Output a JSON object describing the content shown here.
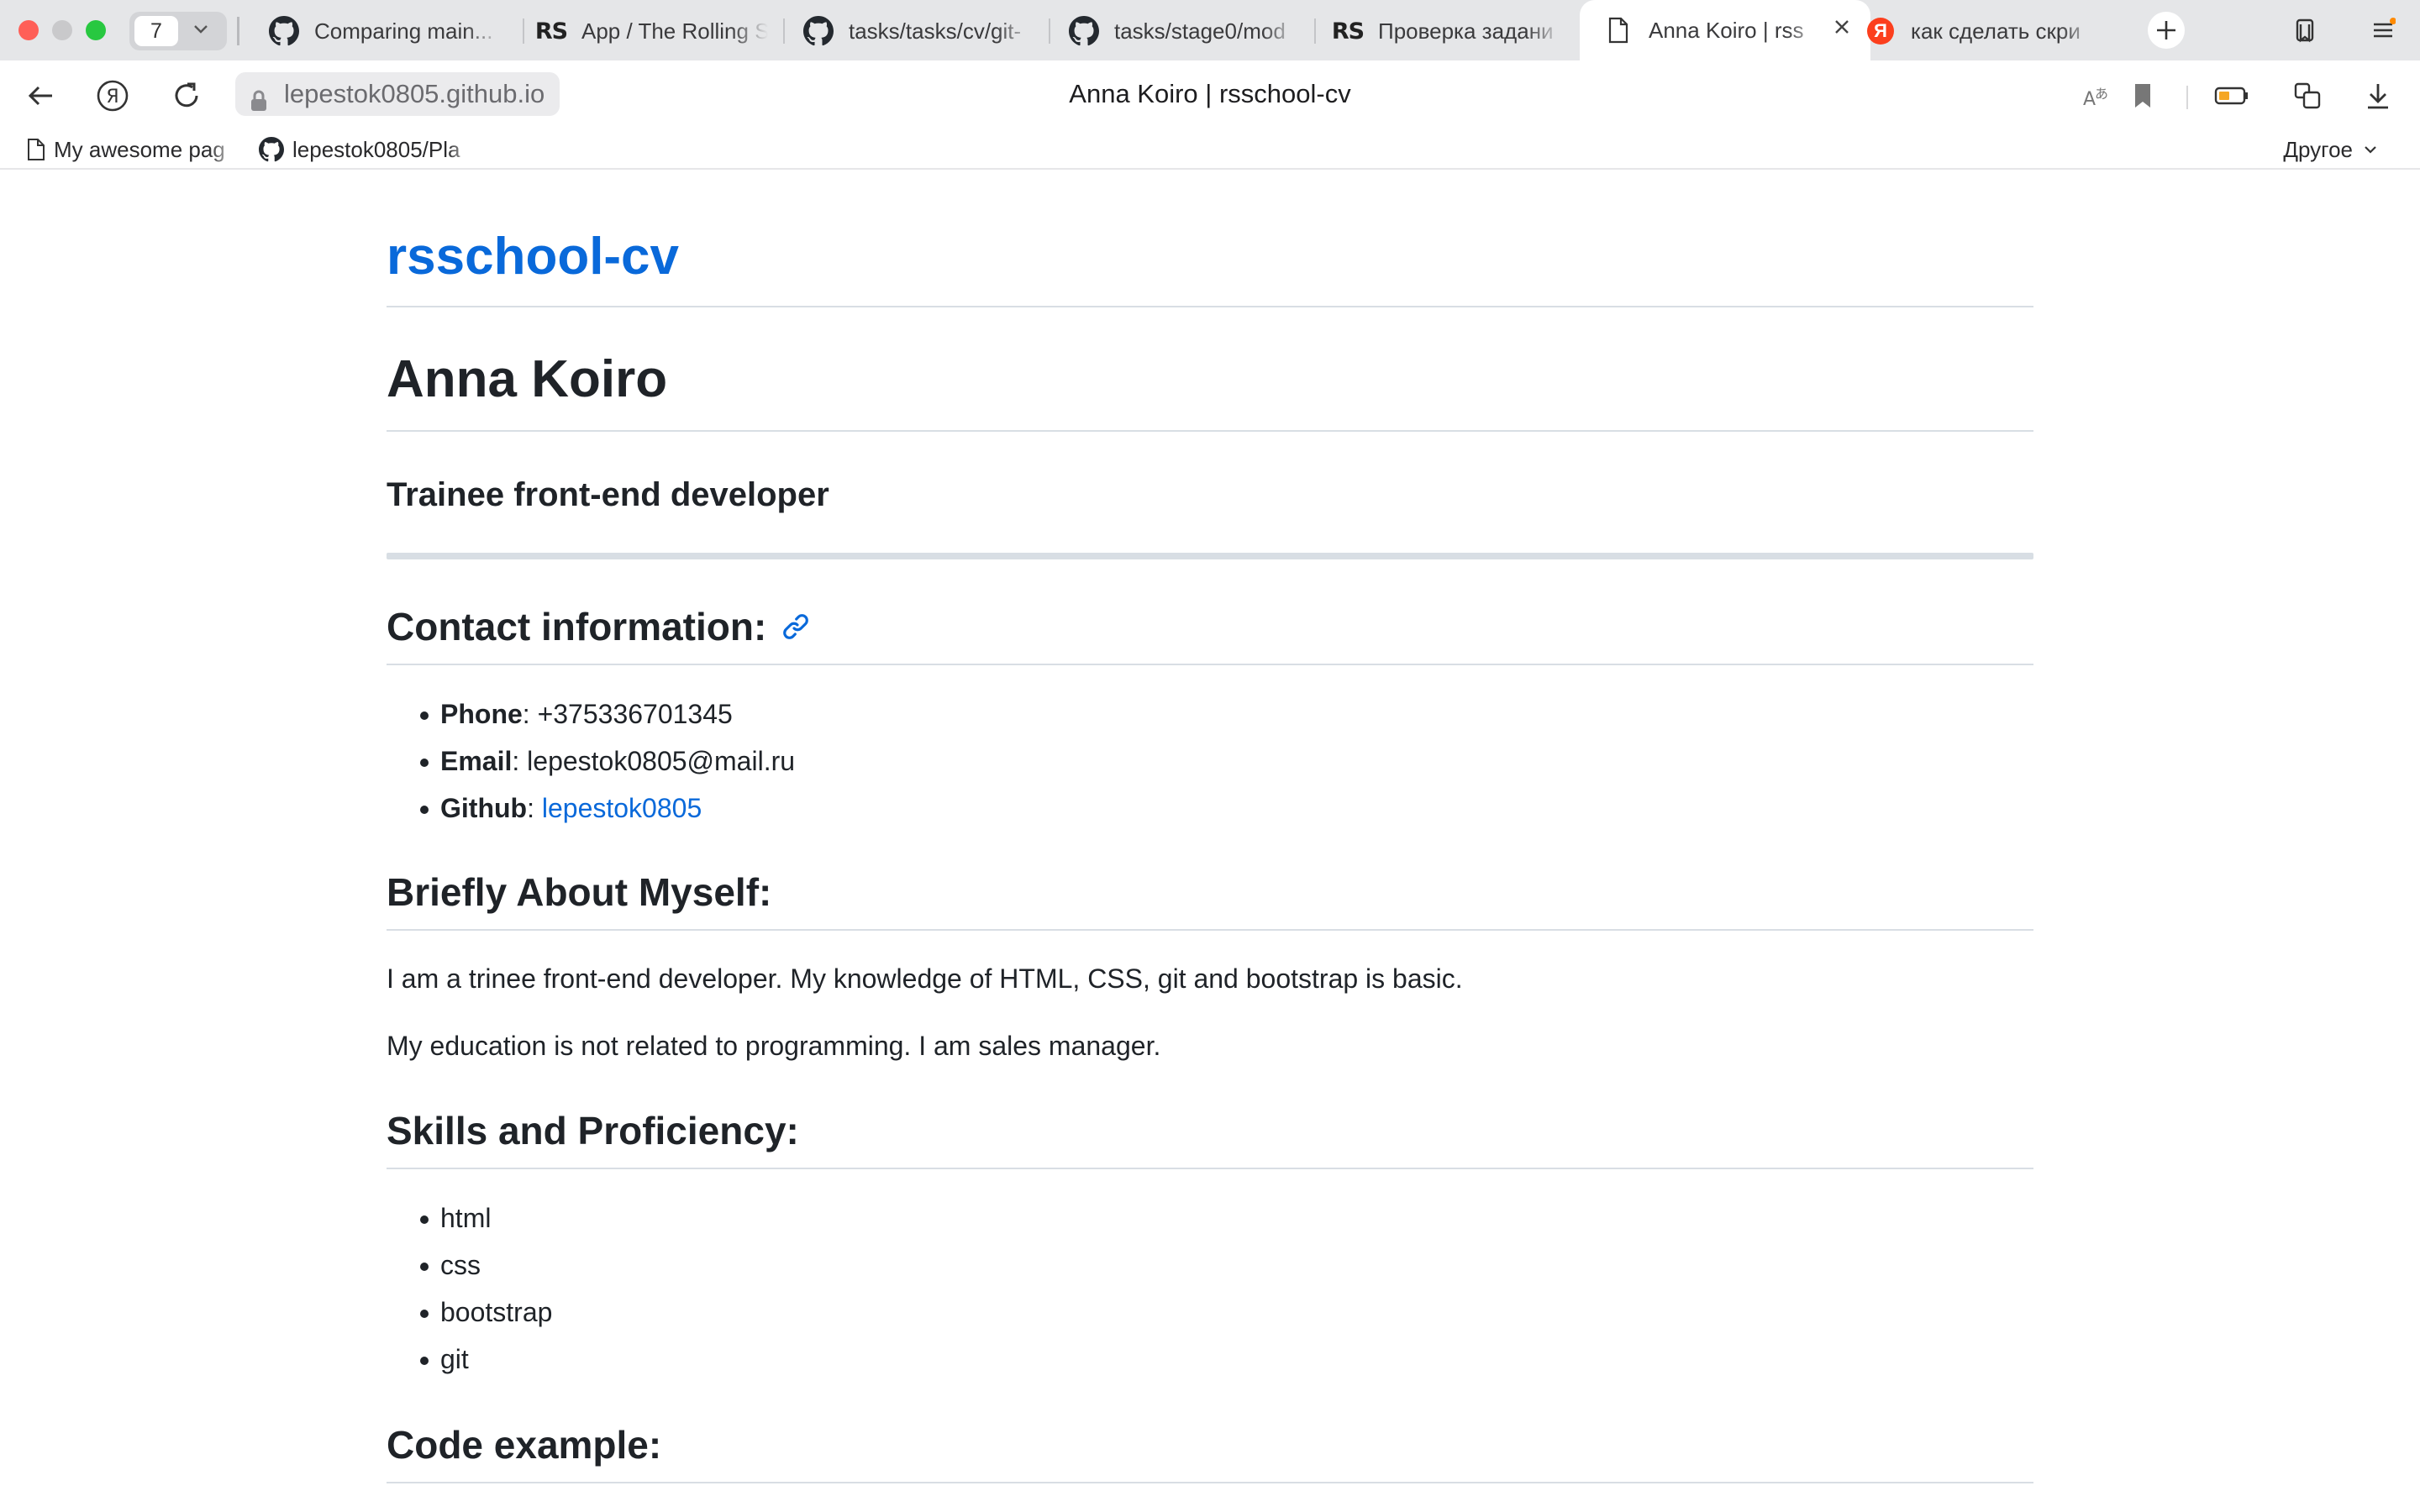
{
  "browser": {
    "tab_count": "7",
    "tabs": [
      {
        "label": "Comparing main...",
        "favicon": "github-icon"
      },
      {
        "label": "App / The Rolling S",
        "favicon": "rs-icon"
      },
      {
        "label": "tasks/tasks/cv/git-",
        "favicon": "github-icon"
      },
      {
        "label": "tasks/stage0/mod",
        "favicon": "github-icon"
      },
      {
        "label": "Проверка задани",
        "favicon": "rs-icon"
      },
      {
        "label": "Anna Koiro | rss",
        "favicon": "page-icon",
        "active": true
      },
      {
        "label": "как сделать скри",
        "favicon": "yandex-icon"
      }
    ],
    "rs_logo_text": "RS",
    "yandex_logo_text": "Я",
    "url": "lepestok0805.github.io",
    "page_title": "Anna Koiro | rsschool-cv",
    "bookmarks": [
      {
        "label": "My awesome pag"
      },
      {
        "label": "lepestok0805/Pla"
      }
    ],
    "other_bookmarks": "Другое"
  },
  "page": {
    "site_title": "rsschool-cv",
    "name": "Anna Koiro",
    "role": "Trainee front-end developer",
    "contact": {
      "heading": "Contact information:",
      "items": [
        {
          "label": "Phone",
          "sep": ": ",
          "value": "+375336701345"
        },
        {
          "label": "Email",
          "sep": ": ",
          "value": "lepestok0805@mail.ru"
        },
        {
          "label": "Github",
          "sep": ": ",
          "value": "lepestok0805"
        }
      ]
    },
    "about": {
      "heading": "Briefly About Myself:",
      "paragraphs": [
        "I am a trinee front-end developer. My knowledge of HTML, CSS, git and bootstrap is basic.",
        "My education is not related to programming. I am sales manager."
      ]
    },
    "skills": {
      "heading": "Skills and Proficiency:",
      "items": [
        "html",
        "css",
        "bootstrap",
        "git"
      ]
    },
    "code": {
      "heading": "Code example:"
    }
  },
  "colors": {
    "link": "#0969da",
    "text": "#1f2328",
    "tabstrip": "#e5e6e8"
  }
}
